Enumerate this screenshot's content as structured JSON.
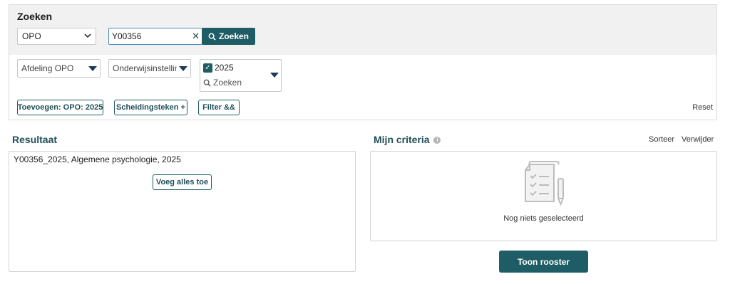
{
  "search": {
    "title": "Zoeken",
    "type_select": "OPO",
    "query_value": "Y00356",
    "clear_icon": "✕",
    "search_button_label": "Zoeken"
  },
  "filters": {
    "department": "Afdeling OPO",
    "institution": "Onderwijsinstelling",
    "year_checked": true,
    "year_label": "2025",
    "year_search_placeholder": "Zoeken"
  },
  "chips": {
    "add": "Toevoegen: OPO: 2025",
    "separator": "Scheidingsteken +",
    "filter": "Filter &&"
  },
  "reset_label": "Reset",
  "results": {
    "title": "Resultaat",
    "items": [
      "Y00356_2025, Algemene psychologie, 2025"
    ],
    "add_all_label": "Voeg alles toe"
  },
  "criteria": {
    "title": "Mijn criteria",
    "sort_label": "Sorteer",
    "remove_label": "Verwijder",
    "empty_text": "Nog niets geselecteerd"
  },
  "show_schedule_label": "Toon rooster",
  "colors": {
    "accent": "#1f5d66",
    "panel_bg": "#f1f1f1",
    "border": "#d4d4d4"
  }
}
